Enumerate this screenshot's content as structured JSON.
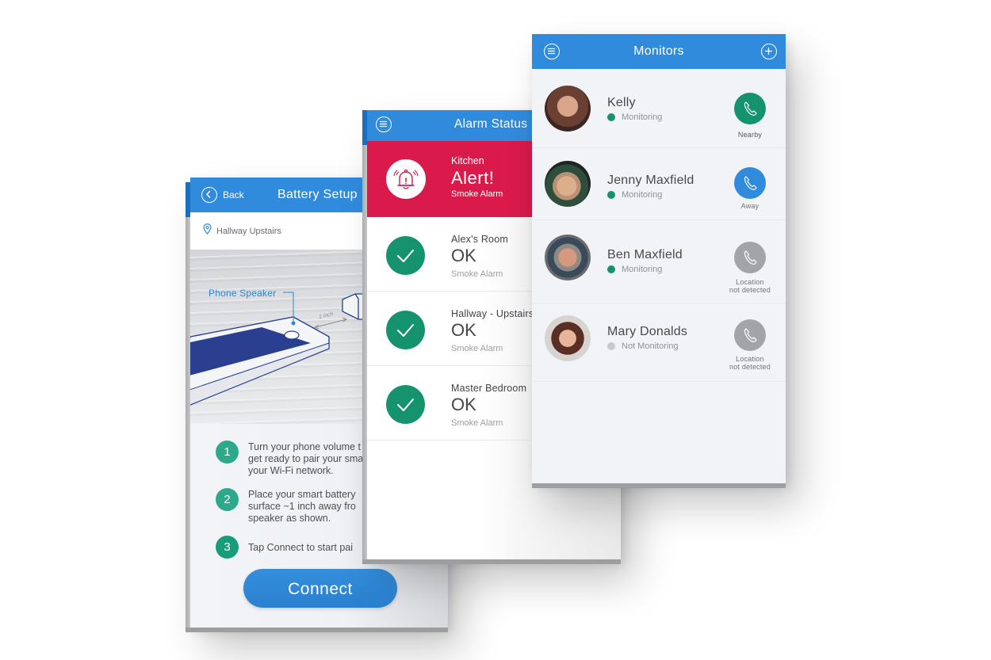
{
  "battery_setup": {
    "back_label": "Back",
    "title": "Battery Setup",
    "location": "Hallway Upstairs",
    "illustration": {
      "speaker_label": "Phone Speaker",
      "distance_label": "1 inch"
    },
    "steps": [
      {
        "number": "1",
        "lines": [
          "Turn your phone volume t",
          "get ready to pair your sma",
          "your Wi-Fi network."
        ]
      },
      {
        "number": "2",
        "lines": [
          "Place your smart battery",
          "surface ~1 inch away fro",
          "speaker as shown."
        ]
      },
      {
        "number": "3",
        "lines": [
          "Tap Connect to start pai"
        ]
      }
    ],
    "connect_label": "Connect"
  },
  "alarm_status": {
    "title": "Alarm Status",
    "alert": {
      "location": "Kitchen",
      "status": "Alert!",
      "type": "Smoke Alarm"
    },
    "alarms": [
      {
        "location": "Alex's Room",
        "status": "OK",
        "type": "Smoke Alarm"
      },
      {
        "location": "Hallway - Upstairs",
        "status": "OK",
        "type": "Smoke Alarm"
      },
      {
        "location": "Master Bedroom",
        "status": "OK",
        "type": "Smoke Alarm"
      }
    ]
  },
  "monitors": {
    "title": "Monitors",
    "people": [
      {
        "name": "Kelly",
        "status": "Monitoring",
        "call_label": "Nearby",
        "call_label_2": ""
      },
      {
        "name": "Jenny Maxfield",
        "status": "Monitoring",
        "call_label": "Away",
        "call_label_2": ""
      },
      {
        "name": "Ben Maxfield",
        "status": "Monitoring",
        "call_label": "Location",
        "call_label_2": "not detected"
      },
      {
        "name": "Mary Donalds",
        "status": "Not Monitoring",
        "call_label": "Location",
        "call_label_2": "not detected"
      }
    ]
  },
  "colors": {
    "header_blue": "#318bdc",
    "alert_red": "#d91a4b",
    "ok_green": "#15936f",
    "monitoring_green": "#15936f",
    "not_monitoring_gray": "#c8c9cd",
    "call_nearby": "#15936f",
    "call_away": "#318bdc",
    "call_unknown": "#a3a4a7",
    "step_green": "#2ea88a"
  }
}
